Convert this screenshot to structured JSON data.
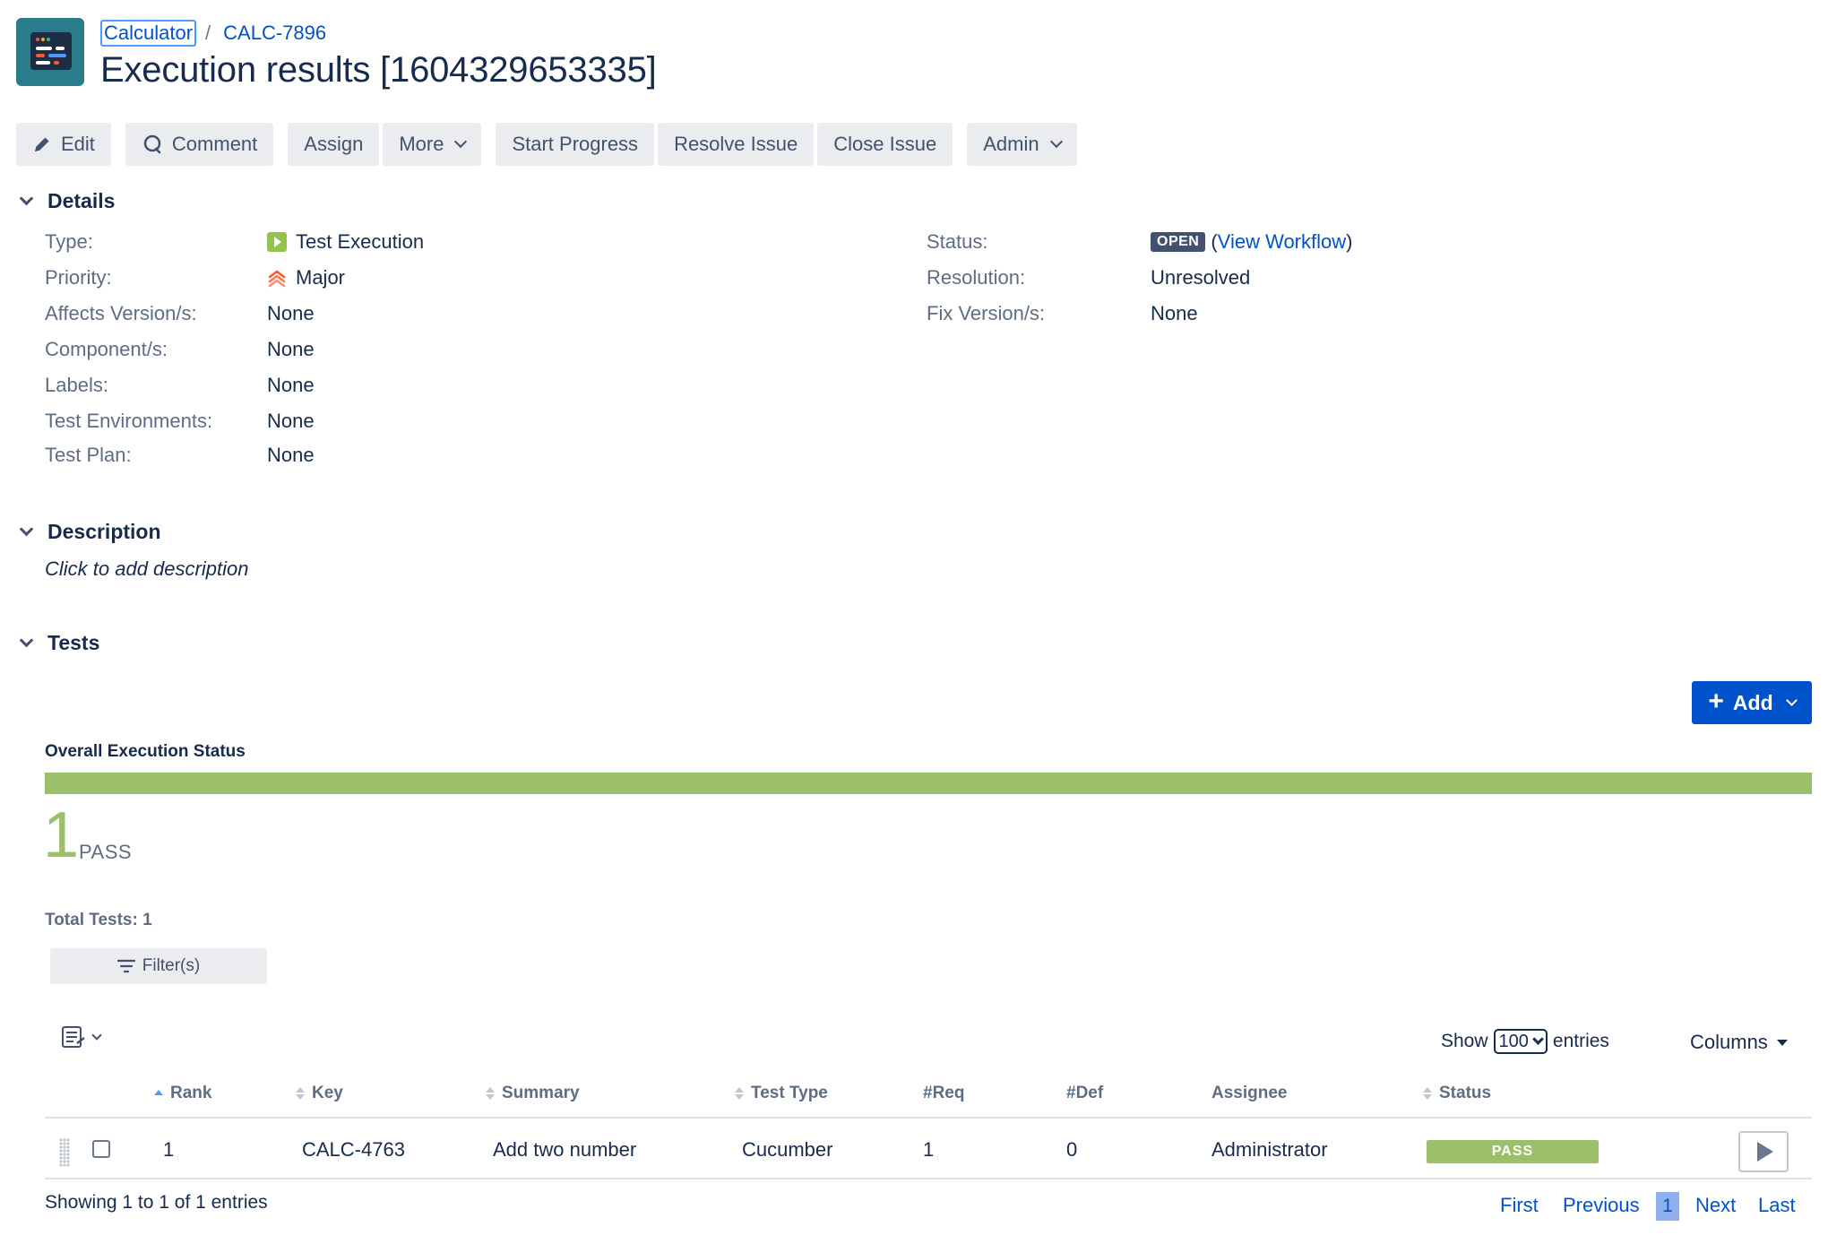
{
  "header": {
    "breadcrumb_project": "Calculator",
    "breadcrumb_separator": "/",
    "breadcrumb_issue": "CALC-7896",
    "title": "Execution results [1604329653335]",
    "avatar_icon": "calculator-project-icon"
  },
  "toolbar": {
    "edit": "Edit",
    "comment": "Comment",
    "assign": "Assign",
    "more": "More",
    "start_progress": "Start Progress",
    "resolve_issue": "Resolve Issue",
    "close_issue": "Close Issue",
    "admin": "Admin"
  },
  "details": {
    "heading": "Details",
    "left": [
      {
        "label": "Type:",
        "value": "Test Execution",
        "icon": "test-execution-icon"
      },
      {
        "label": "Priority:",
        "value": "Major",
        "icon": "priority-major-icon"
      },
      {
        "label": "Affects Version/s:",
        "value": "None"
      },
      {
        "label": "Component/s:",
        "value": "None"
      },
      {
        "label": "Labels:",
        "value": "None"
      },
      {
        "label": "Test Environments:",
        "value": "None"
      },
      {
        "label": "Test Plan:",
        "value": "None"
      }
    ],
    "right": [
      {
        "label": "Status:",
        "badge": "OPEN",
        "open_paren": "(",
        "link": "View Workflow",
        "close_paren": ")"
      },
      {
        "label": "Resolution:",
        "value": "Unresolved"
      },
      {
        "label": "Fix Version/s:",
        "value": "None"
      }
    ]
  },
  "description": {
    "heading": "Description",
    "placeholder": "Click to add description"
  },
  "tests": {
    "heading": "Tests",
    "add_label": "Add",
    "overall_label": "Overall Execution Status",
    "progress_pass_fraction": 1.0,
    "pass_count": "1",
    "pass_label": "PASS",
    "total_tests": "Total Tests: 1",
    "filter_label": "Filter(s)",
    "show_label": "Show",
    "entries_value": "100",
    "entries_label": "entries",
    "columns_label": "Columns",
    "headers": {
      "rank": "Rank",
      "key": "Key",
      "summary": "Summary",
      "test_type": "Test Type",
      "req": "#Req",
      "def": "#Def",
      "assignee": "Assignee",
      "status": "Status"
    },
    "rows": [
      {
        "rank": "1",
        "key": "CALC-4763",
        "summary": "Add two number",
        "test_type": "Cucumber",
        "req": "1",
        "def": "0",
        "assignee": "Administrator",
        "status": "PASS"
      }
    ],
    "showing": "Showing 1 to 1 of 1 entries",
    "pager": {
      "first": "First",
      "previous": "Previous",
      "current": "1",
      "next": "Next",
      "last": "Last"
    }
  },
  "colors": {
    "link": "#0052cc",
    "pass": "#9cbf6a",
    "primary_button": "#0052cc",
    "open_badge": "#42526e"
  }
}
